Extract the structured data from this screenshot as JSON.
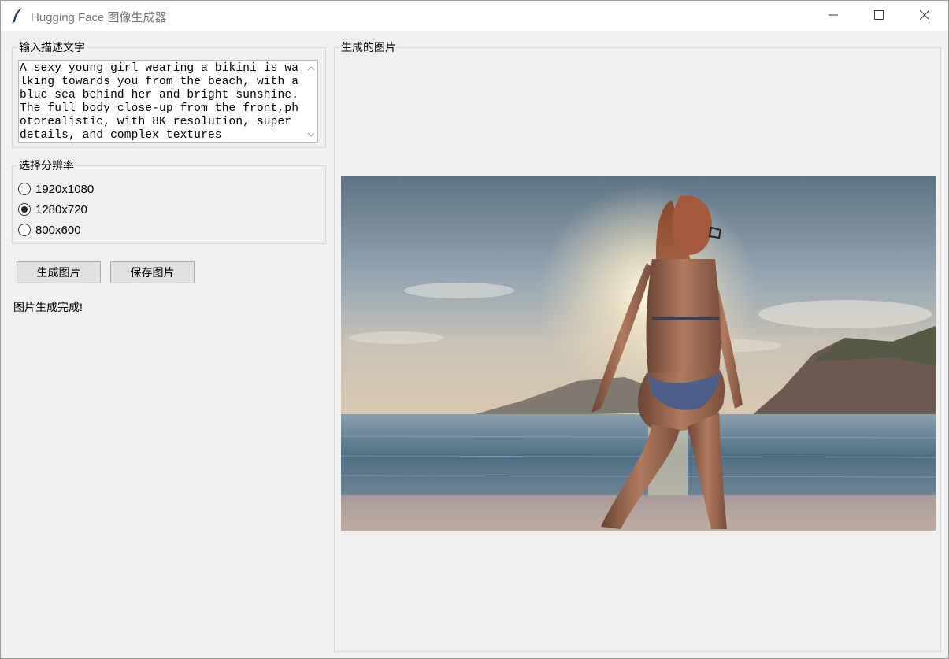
{
  "window": {
    "title": "Hugging Face 图像生成器"
  },
  "description": {
    "label": "输入描述文字",
    "text": "A sexy young girl wearing a bikini is walking towards you from the beach, with a blue sea behind her and bright sunshine.The full body close-up from the front,photorealistic, with 8K resolution, super details, and complex textures"
  },
  "resolution": {
    "label": "选择分辨率",
    "options": [
      "1920x1080",
      "1280x720",
      "800x600"
    ],
    "selected": "1280x720"
  },
  "buttons": {
    "generate": "生成图片",
    "save": "保存图片"
  },
  "status": "图片生成完成!",
  "image_panel": {
    "label": "生成的图片",
    "image_icon": "generated-beach-image"
  },
  "colors": {
    "titlebar": "#ffffff",
    "background": "#f0f0f0",
    "button": "#e1e1e1"
  }
}
